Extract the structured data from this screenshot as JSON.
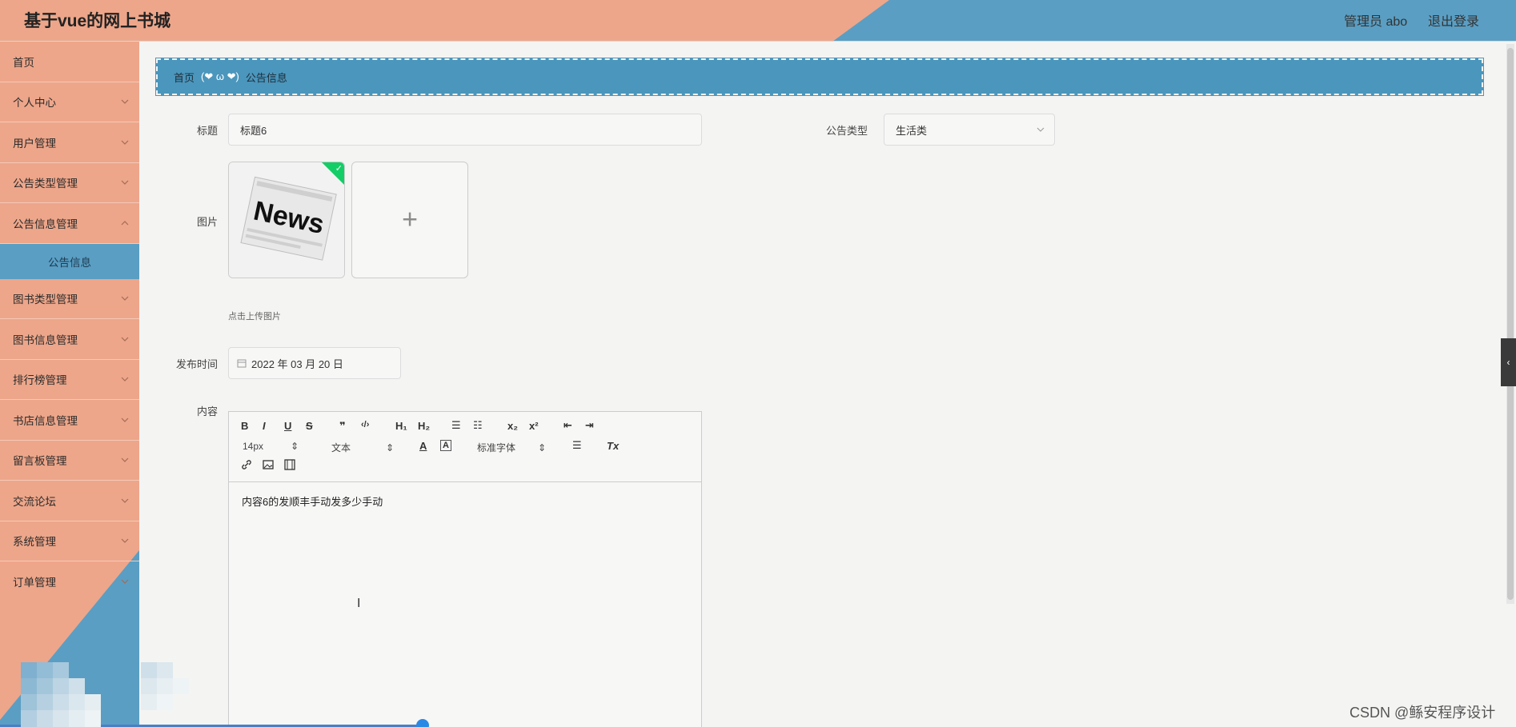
{
  "header": {
    "app_title": "基于vue的网上书城",
    "user_info": "管理员 abo",
    "logout_label": "退出登录"
  },
  "sidebar": {
    "items": [
      {
        "label": "首页",
        "has_arrow": false
      },
      {
        "label": "个人中心",
        "has_arrow": true
      },
      {
        "label": "用户管理",
        "has_arrow": true
      },
      {
        "label": "公告类型管理",
        "has_arrow": true
      },
      {
        "label": "公告信息管理",
        "has_arrow": true,
        "expanded": true
      },
      {
        "label": "图书类型管理",
        "has_arrow": true
      },
      {
        "label": "图书信息管理",
        "has_arrow": true
      },
      {
        "label": "排行榜管理",
        "has_arrow": true
      },
      {
        "label": "书店信息管理",
        "has_arrow": true
      },
      {
        "label": "留言板管理",
        "has_arrow": true
      },
      {
        "label": "交流论坛",
        "has_arrow": true
      },
      {
        "label": "系统管理",
        "has_arrow": true
      },
      {
        "label": "订单管理",
        "has_arrow": true
      }
    ],
    "active_sub_item": "公告信息"
  },
  "breadcrumb": {
    "home": "首页",
    "separator": "(❤ ω ❤)",
    "current": "公告信息"
  },
  "form": {
    "title_label": "标题",
    "title_value": "标题6",
    "type_label": "公告类型",
    "type_value": "生活类",
    "image_label": "图片",
    "image_text": "News",
    "upload_hint": "点击上传图片",
    "date_label": "发布时间",
    "date_value": "2022 年 03 月 20 日",
    "content_label": "内容",
    "content_value": "内容6的发顺丰手动发多少手动"
  },
  "editor_toolbar": {
    "bold": "B",
    "italic": "I",
    "underline": "U",
    "strike": "S",
    "quote": "❞",
    "code": "‹/›",
    "h1": "H₁",
    "h2": "H₂",
    "ordered_list": "☰",
    "bullet_list": "☷",
    "subscript": "x₂",
    "superscript": "x²",
    "outdent": "⇤",
    "indent": "⇥",
    "font_size": "14px",
    "header_select": "文本",
    "font_family": "标准字体",
    "clean": "Tx"
  },
  "watermark": "CSDN @鲧安程序设计",
  "colors": {
    "salmon": "#eda68a",
    "blue": "#5a9ec3",
    "success": "#13ce66"
  }
}
